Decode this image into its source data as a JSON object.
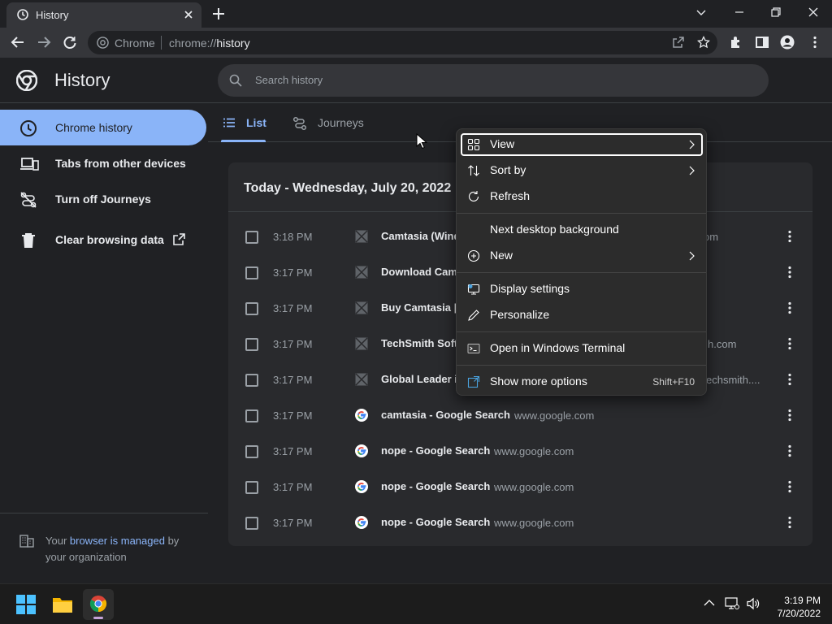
{
  "browser": {
    "tab_title": "History",
    "omnibox_chip": "Chrome",
    "url_scheme": "chrome://",
    "url_host": "history"
  },
  "history_page": {
    "title": "History",
    "search_placeholder": "Search history",
    "tabs": [
      {
        "label": "List"
      },
      {
        "label": "Journeys"
      }
    ],
    "sidebar": {
      "items": [
        {
          "label": "Chrome history"
        },
        {
          "label": "Tabs from other devices"
        },
        {
          "label": "Turn off Journeys"
        },
        {
          "label": "Clear browsing data"
        }
      ],
      "managed_prefix": "Your ",
      "managed_link": "browser is managed",
      "managed_suffix": " by your organization"
    },
    "day_heading": "Today - Wednesday, July 20, 2022",
    "rows": [
      {
        "time": "3:18 PM",
        "title": "Camtasia (Wind",
        "domain": "om",
        "favicon": "broken-image-icon"
      },
      {
        "time": "3:17 PM",
        "title": "Download Camt",
        "domain": "",
        "favicon": "broken-image-icon"
      },
      {
        "time": "3:17 PM",
        "title": "Buy Camtasia |",
        "domain": "",
        "favicon": "broken-image-icon"
      },
      {
        "time": "3:17 PM",
        "title": "TechSmith Soft",
        "domain": "h.com",
        "favicon": "broken-image-icon"
      },
      {
        "time": "3:17 PM",
        "title": "Global Leader in",
        "domain": "echsmith....",
        "favicon": "broken-image-icon"
      },
      {
        "time": "3:17 PM",
        "title": "camtasia - Google Search",
        "domain": "www.google.com",
        "favicon": "google-icon"
      },
      {
        "time": "3:17 PM",
        "title": "nope - Google Search",
        "domain": "www.google.com",
        "favicon": "google-icon"
      },
      {
        "time": "3:17 PM",
        "title": "nope - Google Search",
        "domain": "www.google.com",
        "favicon": "google-icon"
      },
      {
        "time": "3:17 PM",
        "title": "nope - Google Search",
        "domain": "www.google.com",
        "favicon": "google-icon"
      }
    ]
  },
  "context_menu": {
    "items": [
      {
        "label": "View",
        "icon": "view-grid-icon",
        "submenu": true
      },
      {
        "label": "Sort by",
        "icon": "sort-icon",
        "submenu": true
      },
      {
        "label": "Refresh",
        "icon": "refresh-icon"
      },
      {
        "label": "Next desktop background",
        "icon": ""
      },
      {
        "label": "New",
        "icon": "new-plus-icon",
        "submenu": true
      },
      {
        "label": "Display settings",
        "icon": "display-icon"
      },
      {
        "label": "Personalize",
        "icon": "pen-icon"
      },
      {
        "label": "Open in Windows Terminal",
        "icon": "terminal-icon"
      },
      {
        "label": "Show more options",
        "icon": "more-options-icon",
        "shortcut": "Shift+F10"
      }
    ]
  },
  "taskbar": {
    "time": "3:19 PM",
    "date": "7/20/2022"
  },
  "colors": {
    "accent": "#8ab4f8",
    "background": "#202124",
    "card": "#292a2d"
  }
}
